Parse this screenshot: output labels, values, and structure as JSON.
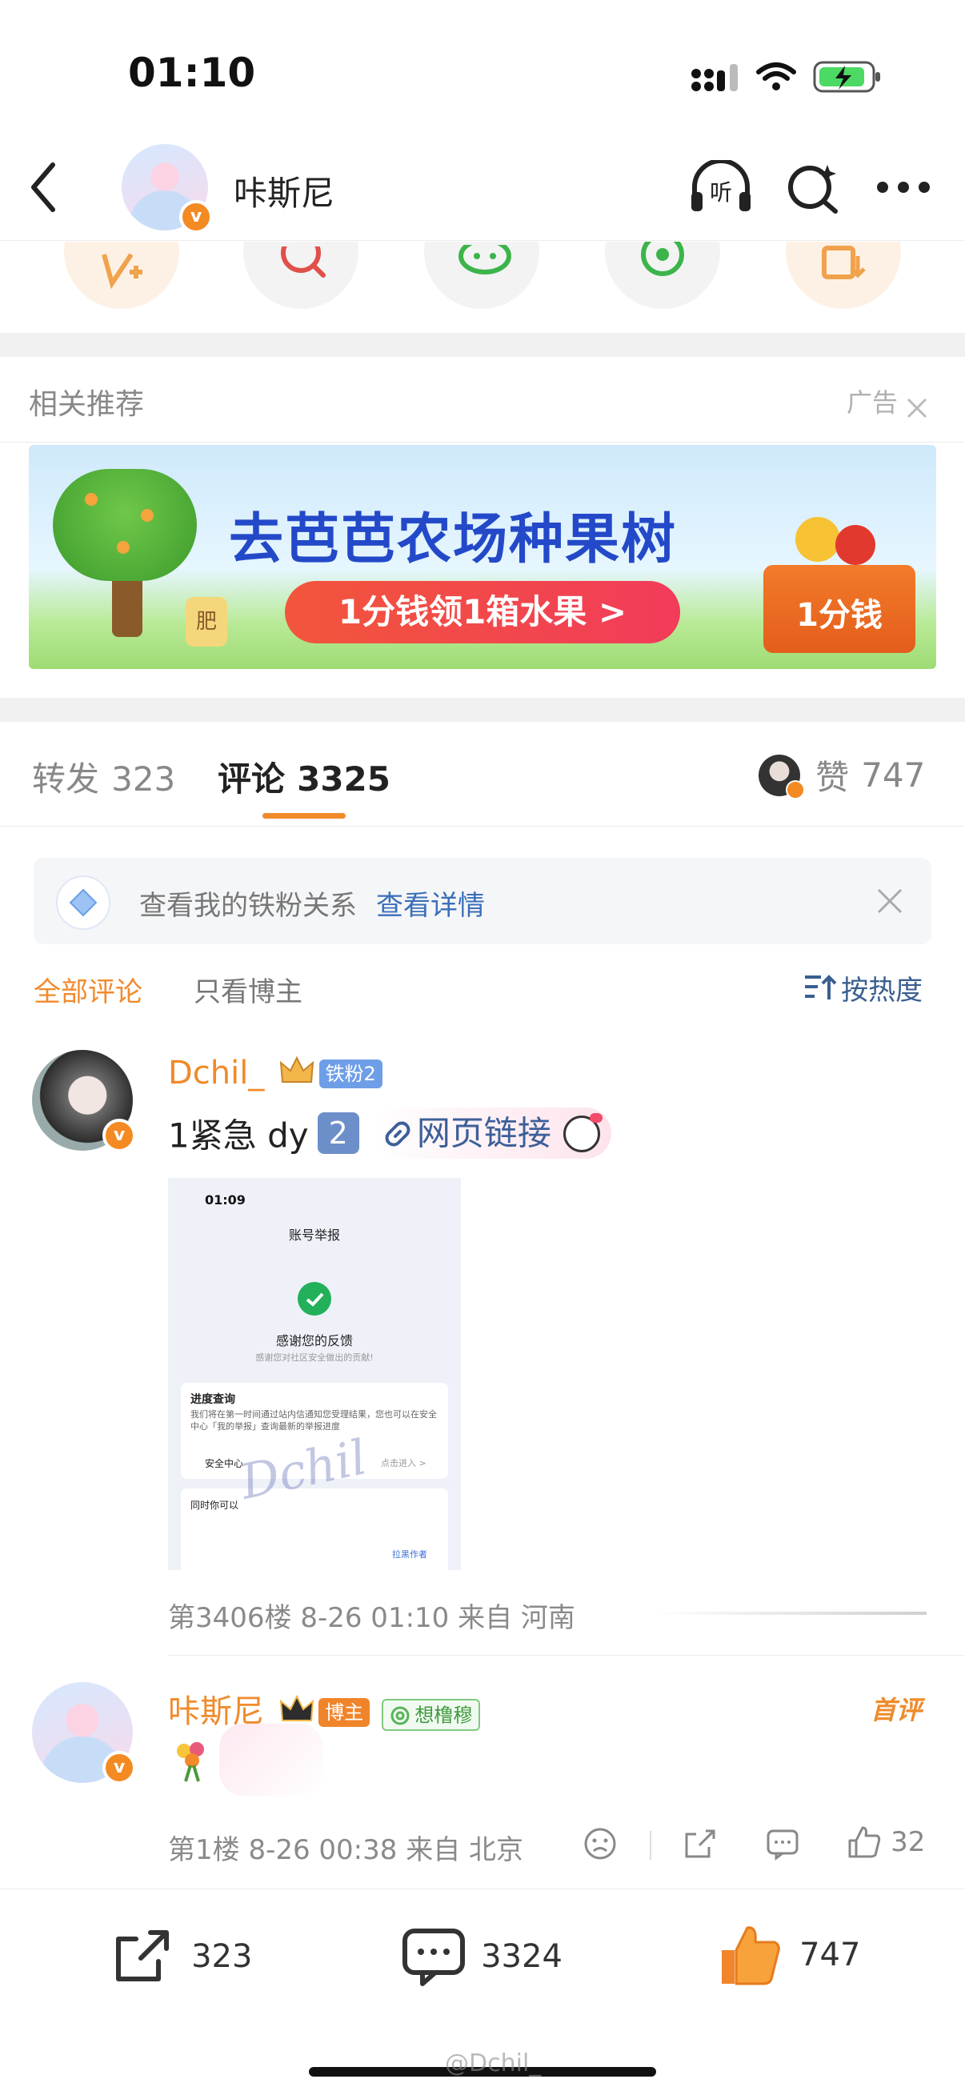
{
  "status_bar": {
    "time": "01:10"
  },
  "header": {
    "account_name": "咔斯尼"
  },
  "recommend": {
    "title": "相关推荐",
    "ad_label": "广告",
    "banner_title": "去芭芭农场种果树",
    "banner_cta": "1分钱领1箱水果 >",
    "banner_badge": "1分钱",
    "banner_fertilizer": "肥"
  },
  "tabs": {
    "repost_label": "转发",
    "repost_count": "323",
    "comment_label": "评论",
    "comment_count": "3325",
    "like_label": "赞",
    "like_count": "747"
  },
  "tip": {
    "text": "查看我的铁粉关系",
    "link": "查看详情"
  },
  "filters": {
    "all": "全部评论",
    "only_owner": "只看博主",
    "sort": "按热度"
  },
  "comments": [
    {
      "user": "Dchil_",
      "badge": "铁粉2",
      "text": "1紧急 dy",
      "num_badge": "2",
      "link_text": "网页链接",
      "meta": "第3406楼  8-26 01:10  来自 河南",
      "screenshot": {
        "time": "01:09",
        "title": "账号举报",
        "thanks": "感谢您的反馈",
        "sub": "感谢您对社区安全做出的贡献!",
        "progress_title": "进度查询",
        "progress_text": "我们将在第一时间通过站内信通知您受理结果，您也可以在安全中心「我的举报」查询最新的举报进度",
        "safety": "安全中心",
        "enter": "点击进入 >",
        "also": "同时你可以",
        "block": "拉黑作者",
        "watermark": "Dchil"
      }
    },
    {
      "user": "咔斯尼",
      "badge_owner": "博主",
      "badge_topic": "想橹穆",
      "first_label": "首评",
      "meta": "第1楼  8-26 00:38  来自 北京",
      "likes": "32"
    }
  ],
  "bottom": {
    "repost": "323",
    "comment": "3324",
    "like": "747"
  },
  "watermark": "@Dchil_"
}
